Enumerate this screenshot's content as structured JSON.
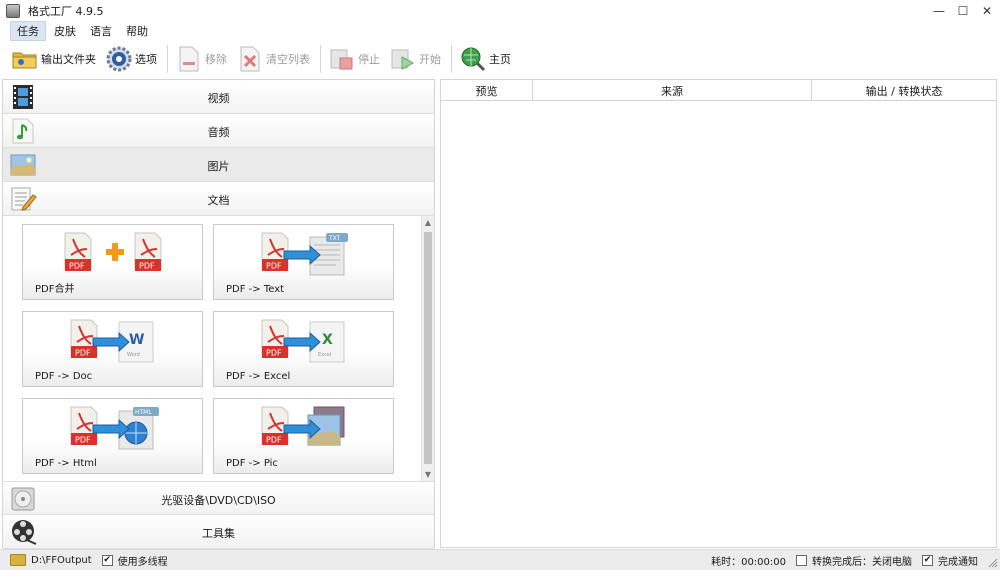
{
  "window": {
    "title": "格式工厂 4.9.5",
    "controls": {
      "minimize": "—",
      "maximize": "☐",
      "close": "✕"
    }
  },
  "menu": {
    "items": [
      {
        "label": "任务",
        "active": true
      },
      {
        "label": "皮肤",
        "active": false
      },
      {
        "label": "语言",
        "active": false
      },
      {
        "label": "帮助",
        "active": false
      }
    ]
  },
  "toolbar": {
    "output_folder": "输出文件夹",
    "options": "选项",
    "remove": "移除",
    "clear_list": "清空列表",
    "stop": "停止",
    "start": "开始",
    "home": "主页"
  },
  "categories": {
    "video": "视频",
    "audio": "音频",
    "picture": "图片",
    "document": "文档",
    "optical": "光驱设备\\DVD\\CD\\ISO",
    "tools": "工具集"
  },
  "tiles": [
    {
      "label": "PDF合并",
      "art": "pdf-merge-icon",
      "badge": "PDF"
    },
    {
      "label": "PDF -> Text",
      "art": "pdf-to-text-icon",
      "badge": "PDF",
      "target": "TXT"
    },
    {
      "label": "PDF -> Doc",
      "art": "pdf-to-doc-icon",
      "badge": "PDF",
      "target": "W",
      "target_caption": "Word"
    },
    {
      "label": "PDF -> Excel",
      "art": "pdf-to-excel-icon",
      "badge": "PDF",
      "target": "X",
      "target_caption": "Excel"
    },
    {
      "label": "PDF -> Html",
      "art": "pdf-to-html-icon",
      "badge": "PDF",
      "target": "HTML"
    },
    {
      "label": "PDF -> Pic",
      "art": "pdf-to-pic-icon",
      "badge": "PDF"
    }
  ],
  "task_grid": {
    "columns": [
      "预览",
      "来源",
      "输出 / 转换状态"
    ]
  },
  "statusbar": {
    "output_path": "D:\\FFOutput",
    "multithread_label": "使用多线程",
    "multithread_checked": true,
    "elapsed": "耗时：00:00:00",
    "after_done_label": "转换完成后：关闭电脑",
    "after_done_checked": false,
    "notify_label": "完成通知",
    "notify_checked": true
  },
  "colors": {
    "pdf_red": "#d8322c",
    "arrow_blue": "#2f8fd8",
    "plus_orange": "#f39a1d",
    "selected_bg": "#eaeaea",
    "menu_active_bg": "#dbe6f4"
  }
}
